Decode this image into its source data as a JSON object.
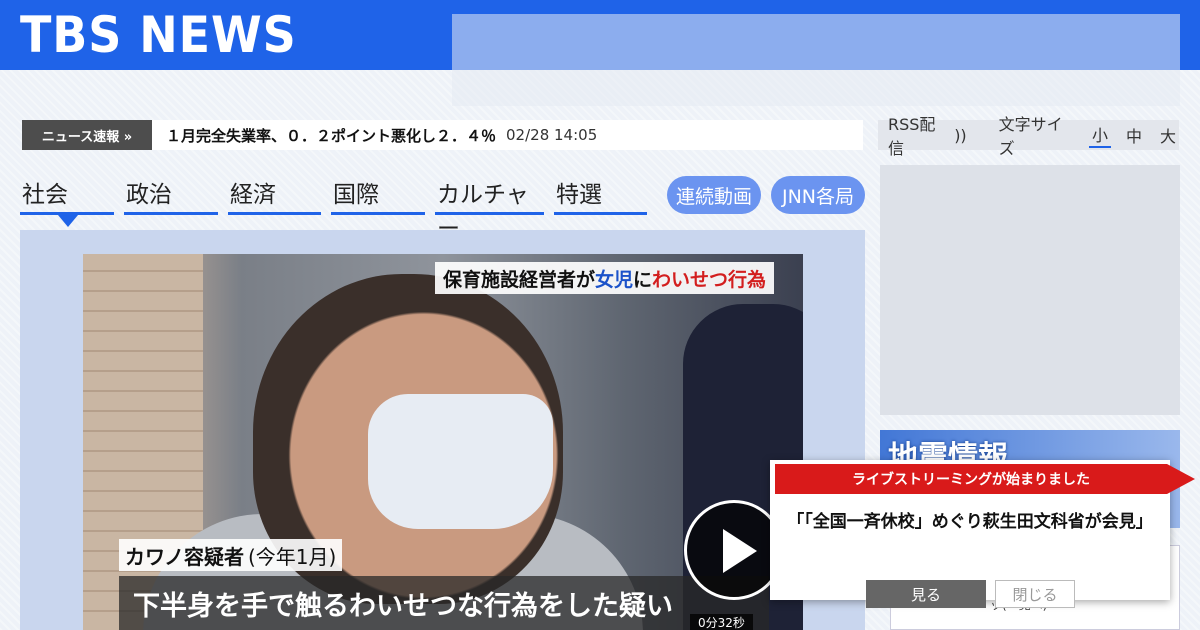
{
  "header": {
    "logo": "TBS NEWS"
  },
  "ticker": {
    "label": "ニュース速報 »",
    "headline": "１月完全失業率、０．２ポイント悪化し２．４％",
    "time": "02/28 14:05"
  },
  "tools": {
    "rss_label": "RSS配信",
    "font_size_label": "文字サイズ",
    "sizes": [
      "小",
      "中",
      "大"
    ],
    "active_size": "小"
  },
  "nav": {
    "tabs": [
      "社会",
      "政治",
      "経済",
      "国際",
      "カルチャー",
      "特選"
    ],
    "active_tab": "社会",
    "pills": [
      "連続動画",
      "JNN各局"
    ]
  },
  "video": {
    "caption_parts": [
      "保育施設経営者が",
      "女児",
      "に",
      "わいせつ行為"
    ],
    "suspect_name": "カワノ容疑者",
    "suspect_note": "(今年1月)",
    "subtitle": "下半身を手で触るわいせつな行為をした疑い",
    "duration": "0分32秒"
  },
  "side": {
    "quake_title": "地震情報",
    "box_text": "ッ(一覧へ)"
  },
  "popup": {
    "ribbon": "ライブストリーミングが始まりました",
    "title": "「「全国一斉休校」めぐり萩生田文科省が会見」",
    "watch_label": "見る",
    "close_label": "閉じる"
  },
  "colors": {
    "brand": "#1f63e8",
    "alert": "#d91a1a",
    "pill": "#6b94f0"
  }
}
